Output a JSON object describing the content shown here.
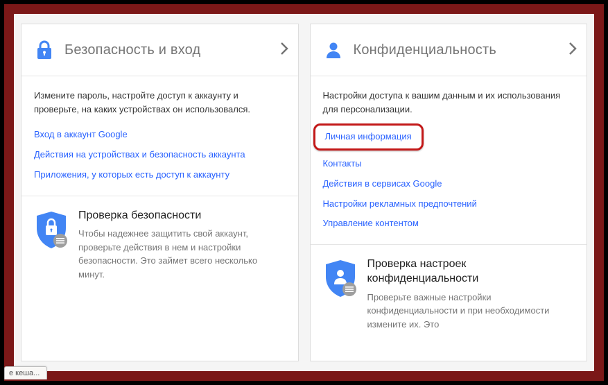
{
  "cards": {
    "security": {
      "title": "Безопасность и вход",
      "description": "Измените пароль, настройте доступ к аккаунту и проверьте, на каких устройствах он использовался.",
      "links": [
        "Вход в аккаунт Google",
        "Действия на устройствах и безопасность аккаунта",
        "Приложения, у которых есть доступ к аккаунту"
      ],
      "subcard": {
        "title": "Проверка безопасности",
        "description": "Чтобы надежнее защитить свой аккаунт, проверьте действия в нем и настройки безопасности. Это займет всего несколько минут."
      }
    },
    "privacy": {
      "title": "Конфиденциальность",
      "description": "Настройки доступа к вашим данным и их использования для персонализации.",
      "links": [
        "Личная информация",
        "Контакты",
        "Действия в сервисах Google",
        "Настройки рекламных предпочтений",
        "Управление контентом"
      ],
      "subcard": {
        "title": "Проверка настроек конфиденциальности",
        "description": "Проверьте важные настройки конфиденциальности и при необходимости измените их. Это"
      }
    }
  },
  "status_tab": "е кеша...",
  "colors": {
    "link": "#2962ff",
    "highlight_border": "#c31818",
    "icon_blue": "#4285f4"
  }
}
